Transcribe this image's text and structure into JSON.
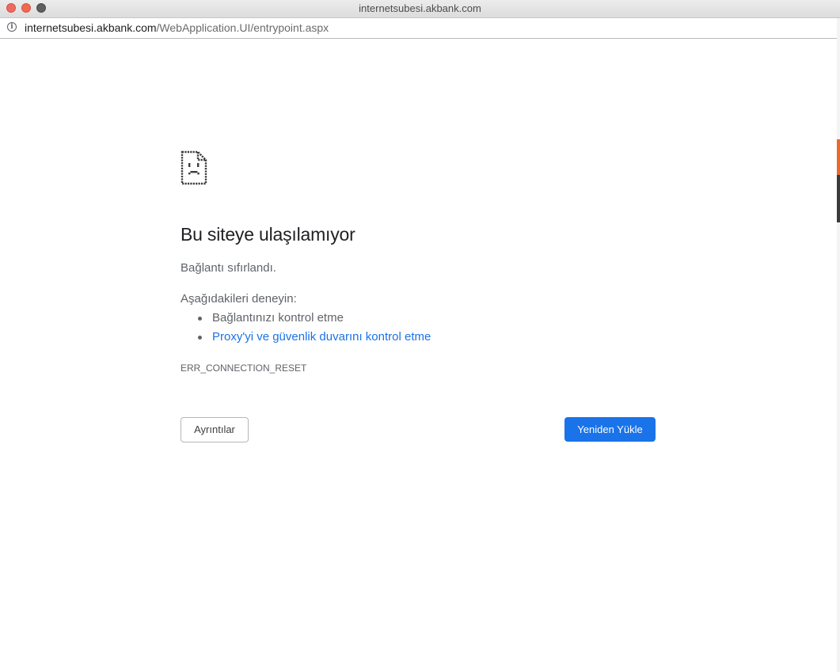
{
  "window": {
    "title": "internetsubesi.akbank.com"
  },
  "address_bar": {
    "host": "internetsubesi.akbank.com",
    "path": "/WebApplication.UI/entrypoint.aspx",
    "icon": "info-icon"
  },
  "error_page": {
    "icon": "sad-document-icon",
    "headline": "Bu siteye ulaşılamıyor",
    "reason": "Bağlantı sıfırlandı.",
    "try_label": "Aşağıdakileri deneyin:",
    "suggestions": [
      {
        "text": "Bağlantınızı kontrol etme",
        "is_link": false
      },
      {
        "text": "Proxy'yi ve güvenlik duvarını kontrol etme",
        "is_link": true
      }
    ],
    "error_code": "ERR_CONNECTION_RESET",
    "details_button": "Ayrıntılar",
    "reload_button": "Yeniden Yükle"
  },
  "colors": {
    "link": "#1a73e8",
    "primary_button": "#1a73e8",
    "text_primary": "#202124",
    "text_secondary": "#5f6368"
  }
}
